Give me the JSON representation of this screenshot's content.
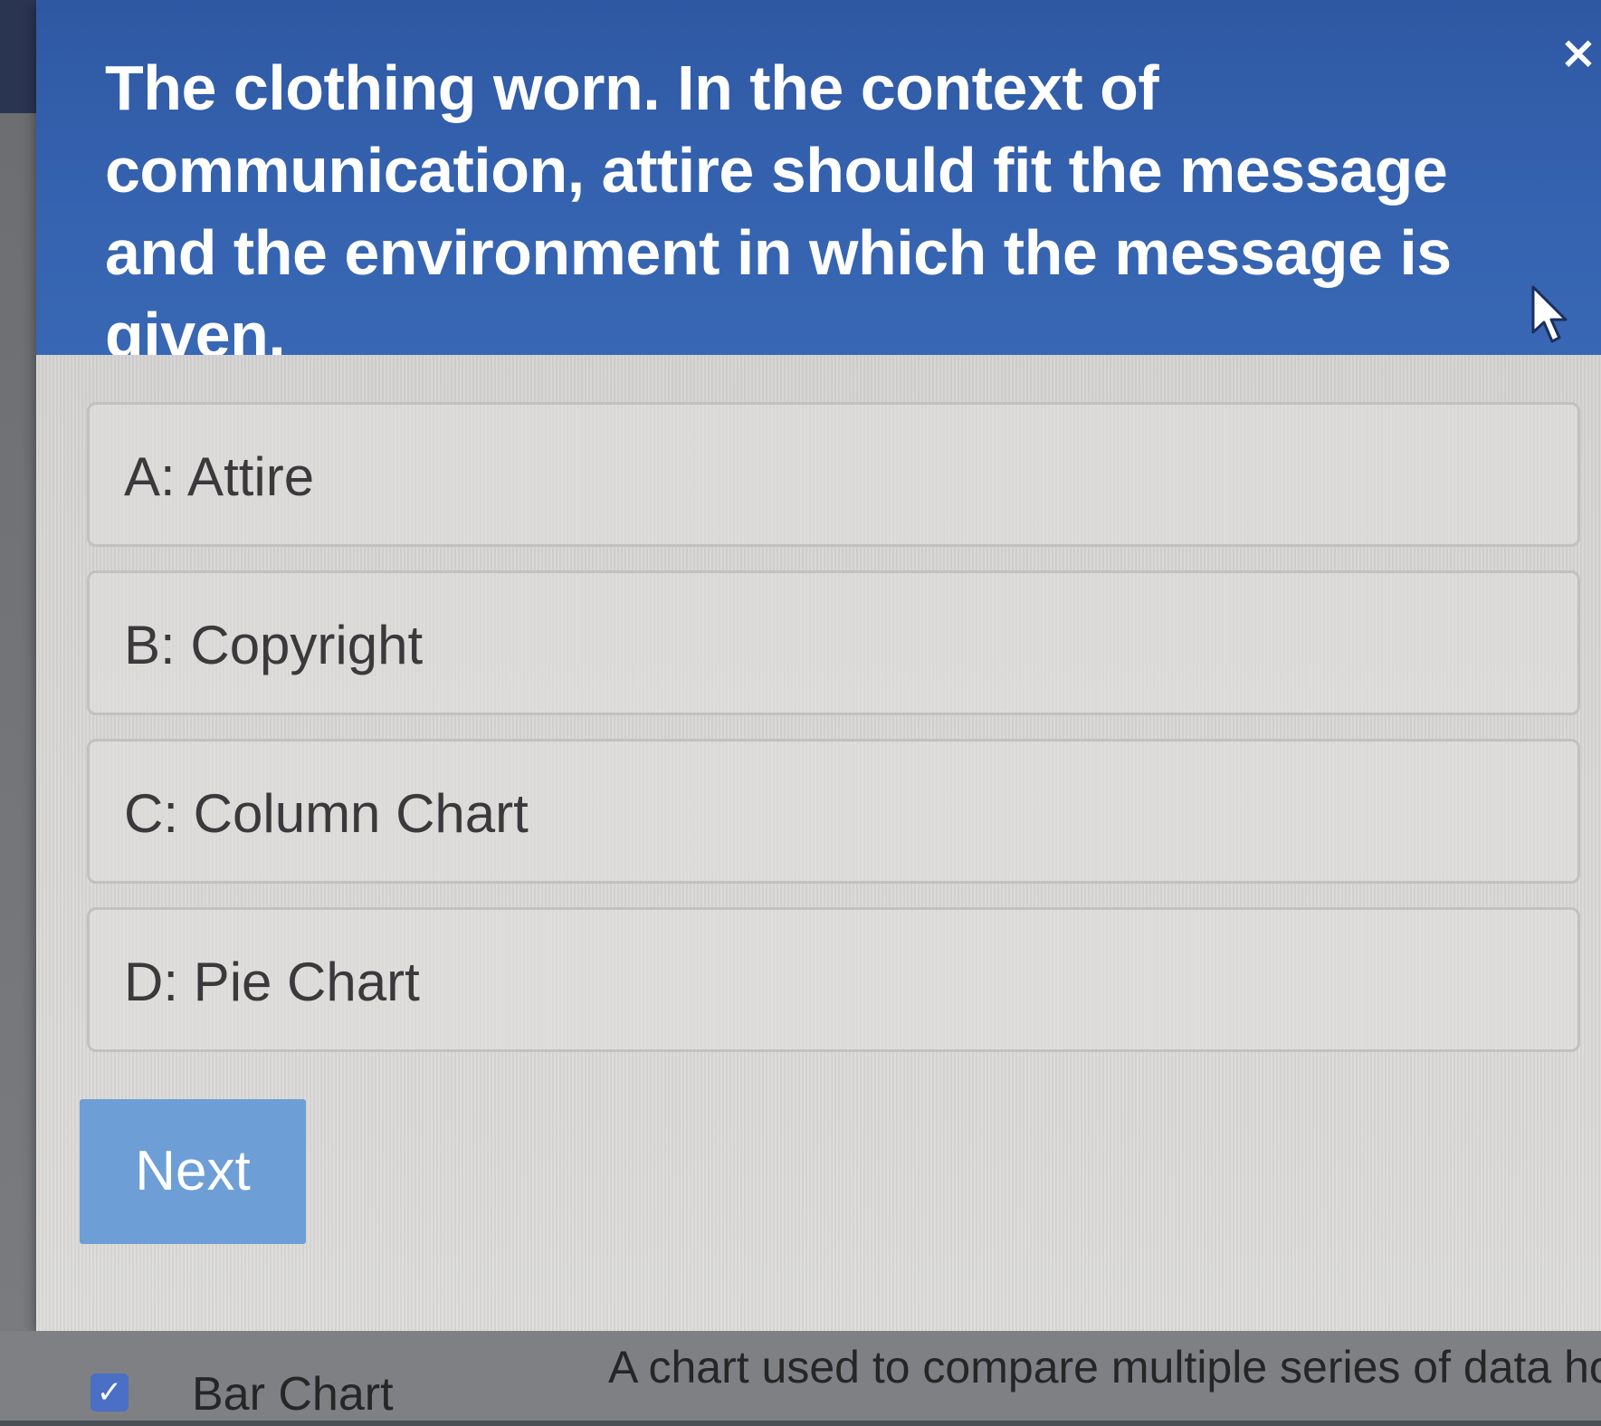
{
  "question": {
    "text": "The clothing worn. In the context of communication, attire should fit the message and the environment in which the message is given."
  },
  "close_button": {
    "label": "×"
  },
  "options": [
    {
      "label": "A: Attire"
    },
    {
      "label": "B: Copyright"
    },
    {
      "label": "C: Column Chart"
    },
    {
      "label": "D: Pie Chart"
    }
  ],
  "next_button": {
    "label": "Next"
  },
  "bottom_row": {
    "checkbox_symbol": "✓",
    "term": "Bar Chart",
    "definition": "A chart used to compare multiple series of data horizontally in rows"
  },
  "colors": {
    "header_blue": "#3563b0",
    "next_button": "#6d9fd6",
    "checkbox": "#4a6fc4"
  },
  "icons": {
    "close": "close-icon",
    "cursor": "mouse-pointer-icon",
    "checkbox": "checkmark-icon"
  }
}
